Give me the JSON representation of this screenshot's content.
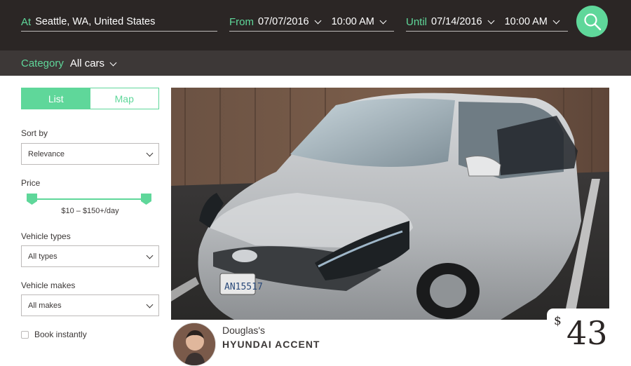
{
  "search": {
    "location_label": "At",
    "location_value": "Seattle, WA, United States",
    "from_label": "From",
    "from_date": "07/07/2016",
    "from_time": "10:00 AM",
    "until_label": "Until",
    "until_date": "07/14/2016",
    "until_time": "10:00 AM"
  },
  "category": {
    "label": "Category",
    "value": "All cars"
  },
  "view_toggle": {
    "list_label": "List",
    "map_label": "Map",
    "active": "List"
  },
  "filters": {
    "sort_by_label": "Sort by",
    "sort_by_value": "Relevance",
    "price_label": "Price",
    "price_range": "$10 – $150+/day",
    "vehicle_types_label": "Vehicle types",
    "vehicle_types_value": "All types",
    "vehicle_makes_label": "Vehicle makes",
    "vehicle_makes_value": "All makes",
    "book_instantly_label": "Book instantly",
    "book_instantly_checked": false
  },
  "listing": {
    "owner_name": "Douglas's",
    "car_name": "HYUNDAI ACCENT",
    "price_currency": "$",
    "price_amount": "43",
    "photo_icon": "silver-hatchback-car-photo"
  },
  "colors": {
    "accent": "#5fd79a",
    "topbar": "#2b2625",
    "category_bar": "#3d3837"
  }
}
